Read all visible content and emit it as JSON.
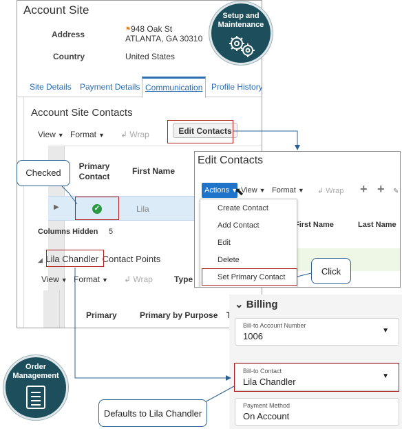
{
  "account_site": {
    "title": "Account Site",
    "address_label": "Address",
    "address_line1": "948 Oak St",
    "address_line2": "ATLANTA, GA 30310",
    "country_label": "Country",
    "country_value": "United States",
    "tabs": [
      "Site Details",
      "Payment Details",
      "Communication",
      "Profile History"
    ],
    "active_tab": "Communication",
    "contacts_title": "Account Site Contacts",
    "toolbar": {
      "view": "View",
      "format": "Format",
      "wrap": "Wrap"
    },
    "edit_contacts_button": "Edit Contacts",
    "columns": {
      "primary_contact": "Primary Contact",
      "first_name": "First Name"
    },
    "row": {
      "first_name": "Lila",
      "primary": true
    },
    "columns_hidden_label": "Columns Hidden",
    "columns_hidden_value": "5",
    "contact_points_name": "Lila Chandler",
    "contact_points_suffix": "Contact Points",
    "contact_points_toolbar": {
      "view": "View",
      "format": "Format",
      "wrap": "Wrap",
      "type": "Type"
    },
    "contact_points_columns": {
      "primary": "Primary",
      "primary_by_purpose": "Primary by Purpose",
      "t": "T"
    }
  },
  "edit_contacts": {
    "title": "Edit Contacts",
    "actions": "Actions",
    "view": "View",
    "format": "Format",
    "wrap": "Wrap",
    "menu": [
      "Create Contact",
      "Add Contact",
      "Edit",
      "Delete",
      "Set Primary Contact"
    ],
    "columns": {
      "first_name": "First Name",
      "last_name": "Last Name"
    }
  },
  "billing": {
    "title": "Billing",
    "fields": [
      {
        "label": "Bill-to Account Number",
        "value": "1006"
      },
      {
        "label": "Bill-to Contact",
        "value": "Lila Chandler"
      },
      {
        "label": "Payment Method",
        "value": "On Account"
      }
    ]
  },
  "callouts": {
    "checked": "Checked",
    "click": "Click",
    "defaults": "Defaults to Lila Chandler"
  },
  "badges": {
    "setup": "Setup and Maintenance",
    "order": "Order Management"
  },
  "colors": {
    "accent": "#2a6db3",
    "highlight": "#b31b1b",
    "badge": "#1c4f5b",
    "check": "#2b9a44"
  }
}
